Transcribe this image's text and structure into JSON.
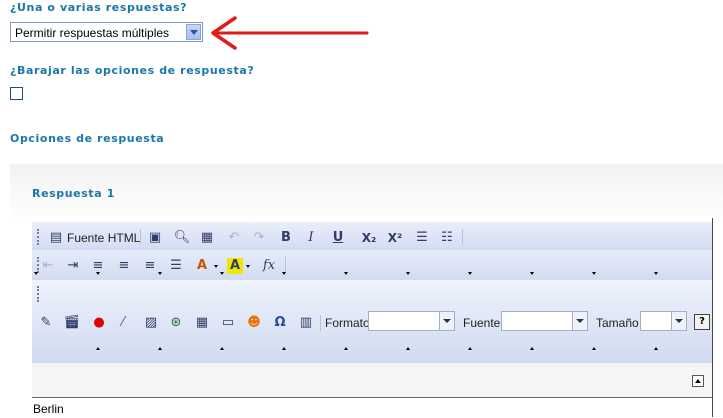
{
  "question_mode": {
    "label": "¿Una o varias respuestas?",
    "select_value": "Permitir respuestas múltiples"
  },
  "shuffle": {
    "label": "¿Barajar las opciones de respuesta?",
    "checked": false
  },
  "options_section": {
    "title": "Opciones de respuesta"
  },
  "answer": {
    "title": "Respuesta 1",
    "content": "Berlin"
  },
  "editor": {
    "toolbar1": {
      "source_label": "Fuente HTML",
      "icons": [
        "source-icon",
        "maximize-icon",
        "preview-icon",
        "paste-word-icon",
        "undo-icon",
        "redo-icon",
        "bold-icon",
        "italic-icon",
        "underline-icon",
        "subscript-icon",
        "superscript-icon",
        "numbered-list-icon",
        "bulleted-list-icon"
      ]
    },
    "toolbar2": {
      "icons": [
        "outdent-icon",
        "indent-icon",
        "align-left-icon",
        "align-center-icon",
        "align-right-icon",
        "justify-icon",
        "text-color-icon",
        "background-color-icon",
        "formula-icon"
      ]
    },
    "toolbar4": {
      "format_label": "Formato",
      "font_label": "Fuente",
      "size_label": "Tamaño",
      "help_label": "?",
      "icons": [
        "edit-icon",
        "media-icon",
        "record-icon",
        "magic-icon",
        "image-icon",
        "link-icon",
        "table-icon",
        "horizontal-rule-icon",
        "emoticon-icon",
        "special-char-icon",
        "template-icon"
      ]
    }
  },
  "colors": {
    "label_blue": "#1a78a8",
    "annotation_arrow": "#e01b1b",
    "toolbar_bg": "#dee5f5"
  }
}
